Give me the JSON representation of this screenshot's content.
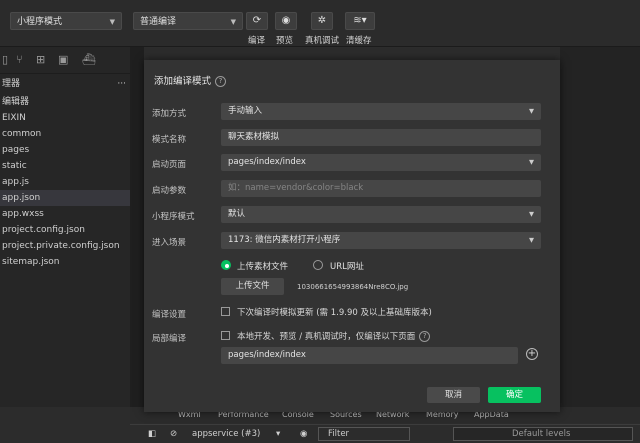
{
  "toolbar": {
    "mode_select": "小程序模式",
    "compile_select": "普通编译",
    "buttons": [
      {
        "label": "编译",
        "icon": "refresh-icon"
      },
      {
        "label": "预览",
        "icon": "eye-icon"
      },
      {
        "label": "真机调试",
        "icon": "bug-icon"
      },
      {
        "label": "清缓存",
        "icon": "layers-icon"
      }
    ]
  },
  "sidebar": {
    "header_partial": "理器",
    "section_partial": "编辑器",
    "project_partial": "EIXIN",
    "items": [
      {
        "label": "common",
        "selected": false
      },
      {
        "label": "pages",
        "selected": false
      },
      {
        "label": "static",
        "selected": false
      },
      {
        "label": "app.js",
        "selected": false
      },
      {
        "label": "app.json",
        "selected": true
      },
      {
        "label": "app.wxss",
        "selected": false
      },
      {
        "label": "project.config.json",
        "selected": false
      },
      {
        "label": "project.private.config.json",
        "selected": false
      },
      {
        "label": "sitemap.json",
        "selected": false
      }
    ]
  },
  "dialog": {
    "title": "添加编译模式",
    "add_method": {
      "label": "添加方式",
      "value": "手动输入"
    },
    "mode_name": {
      "label": "模式名称",
      "value": "聊天素材模拟"
    },
    "start_page": {
      "label": "启动页面",
      "value": "pages/index/index"
    },
    "start_params": {
      "label": "启动参数",
      "placeholder": "如：name=vendor&color=black"
    },
    "mp_mode": {
      "label": "小程序模式",
      "value": "默认"
    },
    "scene": {
      "label": "进入场景",
      "value": "1173: 微信内素材打开小程序"
    },
    "upload_radio": "上传素材文件",
    "url_radio": "URL网址",
    "upload_button": "上传文件",
    "file_name": "1030661654993864Nre8CO.jpg",
    "compile_settings": {
      "label": "编译设置",
      "checkbox_text": "下次编译时模拟更新 (需 1.9.90 及以上基础库版本)"
    },
    "local_compile": {
      "label": "局部编译",
      "checkbox_text": "本地开发、预览 / 真机调试时，仅编译以下页面"
    },
    "local_page": "pages/index/index",
    "cancel": "取消",
    "confirm": "确定"
  },
  "bottom_tabs_partial": [
    "Wxml",
    "Performance",
    "Console",
    "Sources",
    "Network",
    "Memory",
    "AppData"
  ],
  "status": {
    "context_select": "appservice (#3)",
    "filter_placeholder": "Filter",
    "levels": "Default levels"
  },
  "colors": {
    "accent": "#07c160",
    "dialog_bg": "#333333",
    "field_bg": "#464646"
  }
}
